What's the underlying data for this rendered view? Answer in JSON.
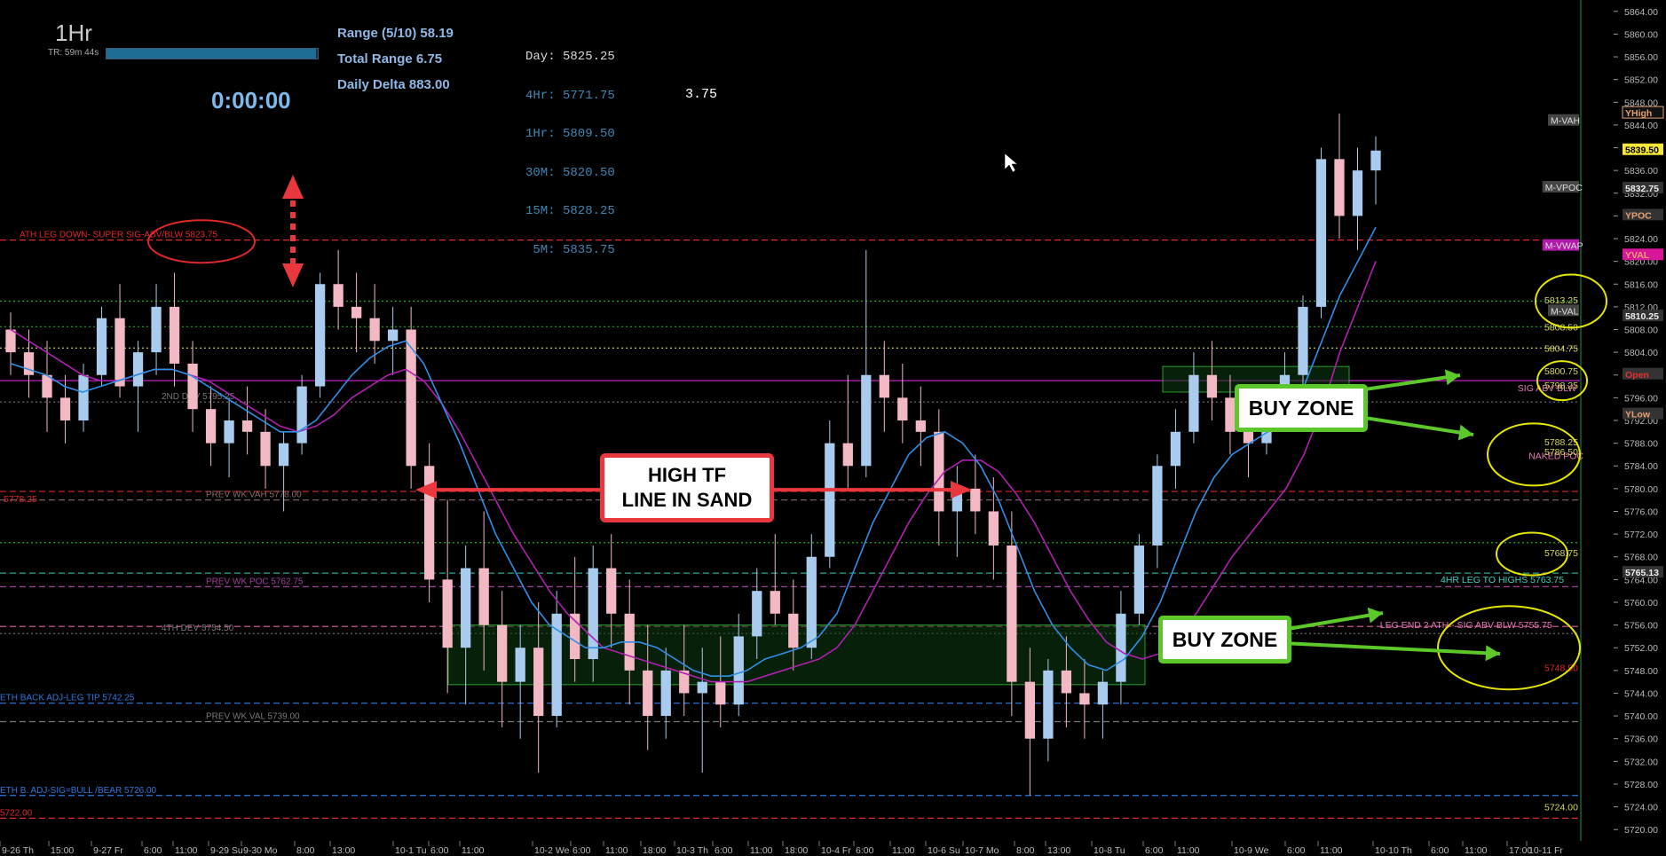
{
  "header": {
    "timeframe": "1Hr",
    "timer_label": "TR: 59m 44s",
    "timer_progress": 0.99,
    "range": "Range (5/10) 58.19",
    "total_range": "Total Range 6.75",
    "daily_delta": "Daily Delta 883.00",
    "clock": "0:00:00",
    "tf_prices": [
      "Day: 5825.25",
      "4Hr: 5771.75",
      "1Hr: 5809.50",
      "30M: 5820.50",
      "15M: 5828.25",
      " 5M: 5835.75"
    ],
    "delta_value": "3.75"
  },
  "callouts": {
    "line_in_sand": [
      "HIGH TF",
      "LINE IN SAND"
    ],
    "buy_zone_upper": "BUY ZONE",
    "buy_zone_lower": "BUY ZONE"
  },
  "colors": {
    "background": "#000000",
    "up_candle": "#a8cbee",
    "down_candle": "#f2b8c4",
    "ema_fast": "#2f8fe6",
    "ema_slow": "#b020b0",
    "callout_red": "#e8383d",
    "callout_green": "#5cc82a",
    "ellipse_yellow": "#e6e600"
  },
  "chart_data": {
    "type": "candlestick",
    "y_axis": {
      "ylim": [
        5718,
        5866
      ],
      "ticks": [
        5720,
        5724,
        5728,
        5732,
        5736,
        5740,
        5744,
        5748,
        5752,
        5756,
        5760,
        5764,
        5768,
        5772,
        5776,
        5780,
        5784,
        5788,
        5792,
        5796,
        5800,
        5804,
        5808,
        5812,
        5816,
        5820,
        5824,
        5828,
        5832,
        5836,
        5840,
        5844,
        5848,
        5852,
        5856,
        5860,
        5864
      ]
    },
    "x_axis": {
      "labels": [
        "9-26 Th",
        "15:00",
        "9-27 Fr",
        "6:00",
        "11:00",
        "9-29 Su",
        "9-30 Mo",
        "8:00",
        "13:00",
        "10-1 Tu",
        "6:00",
        "11:00",
        "10-2 We",
        "6:00",
        "11:00",
        "18:00",
        "10-3 Th",
        "6:00",
        "11:00",
        "18:00",
        "10-4 Fr",
        "6:00",
        "11:00",
        "10-6 Su",
        "10-7 Mo",
        "8:00",
        "13:00",
        "10-8 Tu",
        "6:00",
        "11:00",
        "10-9 We",
        "6:00",
        "11:00",
        "10-10 Th",
        "6:00",
        "11:00",
        "17:00",
        "10-11 Fr"
      ]
    },
    "levels": [
      {
        "price": 5823.75,
        "label": "ATH LEG DOWN- SUPER SIG-ABV/BLW  5823.75",
        "color": "#e02828",
        "style": "dash"
      },
      {
        "price": 5813,
        "label": "",
        "color": "#1fae1f",
        "style": "dot"
      },
      {
        "price": 5808.5,
        "label": "",
        "color": "#1fae1f",
        "style": "dot"
      },
      {
        "price": 5804.75,
        "label": "",
        "color": "#d8d860",
        "style": "dot"
      },
      {
        "price": 5799,
        "label": "",
        "color": "#c020c0",
        "style": "solid"
      },
      {
        "price": 5795.25,
        "label": "2ND DEV  5795.25",
        "color": "#777777",
        "style": "dot"
      },
      {
        "price": 5779.5,
        "label": "",
        "color": "#e02828",
        "style": "dash"
      },
      {
        "price": 5778,
        "label": "PREV WK VAH  5778.00",
        "color": "#8a6a6a",
        "style": "dash"
      },
      {
        "price": 5770.5,
        "label": "",
        "color": "#1fae1f",
        "style": "dot"
      },
      {
        "price": 5765.13,
        "label": "",
        "color": "#2aa89a",
        "style": "dash"
      },
      {
        "price": 5762.75,
        "label": "PREV WK POC  5762.75",
        "color": "#a0409a",
        "style": "dash"
      },
      {
        "price": 5755.75,
        "label": "",
        "color": "#e060a0",
        "style": "dash"
      },
      {
        "price": 5754.5,
        "label": "4TH DEV  5754.50",
        "color": "#777777",
        "style": "dot"
      },
      {
        "price": 5742.25,
        "label": "ETH BACK ADJ-LEG TIP  5742.25",
        "color": "#2f78e0",
        "style": "dash"
      },
      {
        "price": 5739,
        "label": "PREV WK VAL  5739.00",
        "color": "#777777",
        "style": "dash"
      },
      {
        "price": 5726,
        "label": "ETH B. ADJ-SIG=BULL /BEAR  5726.00",
        "color": "#2f78e0",
        "style": "dash"
      },
      {
        "price": 5722,
        "label": "5722.00",
        "color": "#e02828",
        "style": "dash"
      }
    ],
    "right_labels": [
      {
        "price": 5844.5,
        "text": "M-VAH"
      },
      {
        "price": 5832.75,
        "text": "M-VPOC"
      },
      {
        "price": 5822.5,
        "text": "M-VWAP"
      },
      {
        "price": 5811,
        "text": "M-VAL"
      },
      {
        "price": 5797.5,
        "text": "SIG ABV BLW"
      },
      {
        "price": 5785.5,
        "text": "NAKED POC"
      },
      {
        "price": 5763.75,
        "text": "4HR LEG TO HIGHS  5763.75"
      },
      {
        "price": 5755.75,
        "text": "LEG END 2 ATH - SIG ABV BLW  5755.75"
      }
    ],
    "price_labels": [
      {
        "price": 5813.25,
        "text": "5813.25"
      },
      {
        "price": 5808.5,
        "text": "5808.50"
      },
      {
        "price": 5804.75,
        "text": "5804.75"
      },
      {
        "price": 5800.75,
        "text": "5800.75"
      },
      {
        "price": 5798.25,
        "text": "5798.25"
      },
      {
        "price": 5788.25,
        "text": "5788.25"
      },
      {
        "price": 5786.5,
        "text": "5786.50"
      },
      {
        "price": 5768.75,
        "text": "5768.75"
      },
      {
        "price": 5748.5,
        "text": "5748.50"
      },
      {
        "price": 5724,
        "text": "5724.00"
      },
      {
        "price": 5778.25,
        "text": "5778.25"
      }
    ],
    "axis_tags": [
      {
        "price": 5846,
        "text": "YHigh"
      },
      {
        "price": 5839.5,
        "text": "5839.50"
      },
      {
        "price": 5832.75,
        "text": "5832.75"
      },
      {
        "price": 5828,
        "text": "YPOC"
      },
      {
        "price": 5821,
        "text": "YVAL"
      },
      {
        "price": 5810.25,
        "text": "5810.25"
      },
      {
        "price": 5800,
        "text": "Open"
      },
      {
        "price": 5793,
        "text": "YLow"
      },
      {
        "price": 5765.13,
        "text": "5765.13"
      }
    ],
    "candles": [
      {
        "o": 5808,
        "h": 5811,
        "l": 5800,
        "c": 5804
      },
      {
        "o": 5804,
        "h": 5808,
        "l": 5796,
        "c": 5800
      },
      {
        "o": 5800,
        "h": 5806,
        "l": 5790,
        "c": 5796
      },
      {
        "o": 5796,
        "h": 5800,
        "l": 5788,
        "c": 5792
      },
      {
        "o": 5792,
        "h": 5802,
        "l": 5790,
        "c": 5800
      },
      {
        "o": 5800,
        "h": 5812,
        "l": 5798,
        "c": 5810
      },
      {
        "o": 5810,
        "h": 5816,
        "l": 5796,
        "c": 5798
      },
      {
        "o": 5798,
        "h": 5806,
        "l": 5790,
        "c": 5804
      },
      {
        "o": 5804,
        "h": 5816,
        "l": 5800,
        "c": 5812
      },
      {
        "o": 5812,
        "h": 5818,
        "l": 5798,
        "c": 5802
      },
      {
        "o": 5802,
        "h": 5806,
        "l": 5790,
        "c": 5794
      },
      {
        "o": 5794,
        "h": 5798,
        "l": 5784,
        "c": 5788
      },
      {
        "o": 5788,
        "h": 5796,
        "l": 5782,
        "c": 5792
      },
      {
        "o": 5792,
        "h": 5798,
        "l": 5786,
        "c": 5790
      },
      {
        "o": 5790,
        "h": 5794,
        "l": 5780,
        "c": 5784
      },
      {
        "o": 5784,
        "h": 5790,
        "l": 5776,
        "c": 5788
      },
      {
        "o": 5788,
        "h": 5800,
        "l": 5786,
        "c": 5798
      },
      {
        "o": 5798,
        "h": 5818,
        "l": 5796,
        "c": 5816
      },
      {
        "o": 5816,
        "h": 5822,
        "l": 5808,
        "c": 5812
      },
      {
        "o": 5812,
        "h": 5818,
        "l": 5804,
        "c": 5810
      },
      {
        "o": 5810,
        "h": 5816,
        "l": 5802,
        "c": 5806
      },
      {
        "o": 5806,
        "h": 5812,
        "l": 5800,
        "c": 5808
      },
      {
        "o": 5808,
        "h": 5812,
        "l": 5780,
        "c": 5784
      },
      {
        "o": 5784,
        "h": 5788,
        "l": 5760,
        "c": 5764
      },
      {
        "o": 5764,
        "h": 5778,
        "l": 5744,
        "c": 5752
      },
      {
        "o": 5752,
        "h": 5770,
        "l": 5742,
        "c": 5766
      },
      {
        "o": 5766,
        "h": 5776,
        "l": 5748,
        "c": 5756
      },
      {
        "o": 5756,
        "h": 5762,
        "l": 5738,
        "c": 5746
      },
      {
        "o": 5746,
        "h": 5756,
        "l": 5736,
        "c": 5752
      },
      {
        "o": 5752,
        "h": 5760,
        "l": 5730,
        "c": 5740
      },
      {
        "o": 5740,
        "h": 5762,
        "l": 5738,
        "c": 5758
      },
      {
        "o": 5758,
        "h": 5768,
        "l": 5746,
        "c": 5750
      },
      {
        "o": 5750,
        "h": 5770,
        "l": 5746,
        "c": 5766
      },
      {
        "o": 5766,
        "h": 5772,
        "l": 5752,
        "c": 5758
      },
      {
        "o": 5758,
        "h": 5764,
        "l": 5742,
        "c": 5748
      },
      {
        "o": 5748,
        "h": 5756,
        "l": 5734,
        "c": 5740
      },
      {
        "o": 5740,
        "h": 5752,
        "l": 5736,
        "c": 5748
      },
      {
        "o": 5748,
        "h": 5756,
        "l": 5740,
        "c": 5744
      },
      {
        "o": 5744,
        "h": 5752,
        "l": 5730,
        "c": 5746
      },
      {
        "o": 5746,
        "h": 5754,
        "l": 5738,
        "c": 5742
      },
      {
        "o": 5742,
        "h": 5758,
        "l": 5740,
        "c": 5754
      },
      {
        "o": 5754,
        "h": 5766,
        "l": 5750,
        "c": 5762
      },
      {
        "o": 5762,
        "h": 5772,
        "l": 5756,
        "c": 5758
      },
      {
        "o": 5758,
        "h": 5764,
        "l": 5748,
        "c": 5752
      },
      {
        "o": 5752,
        "h": 5772,
        "l": 5750,
        "c": 5768
      },
      {
        "o": 5768,
        "h": 5792,
        "l": 5766,
        "c": 5788
      },
      {
        "o": 5788,
        "h": 5800,
        "l": 5780,
        "c": 5784
      },
      {
        "o": 5784,
        "h": 5822,
        "l": 5782,
        "c": 5800
      },
      {
        "o": 5800,
        "h": 5806,
        "l": 5790,
        "c": 5796
      },
      {
        "o": 5796,
        "h": 5802,
        "l": 5788,
        "c": 5792
      },
      {
        "o": 5792,
        "h": 5798,
        "l": 5784,
        "c": 5790
      },
      {
        "o": 5790,
        "h": 5794,
        "l": 5770,
        "c": 5776
      },
      {
        "o": 5776,
        "h": 5784,
        "l": 5768,
        "c": 5780
      },
      {
        "o": 5780,
        "h": 5786,
        "l": 5772,
        "c": 5776
      },
      {
        "o": 5776,
        "h": 5782,
        "l": 5764,
        "c": 5770
      },
      {
        "o": 5770,
        "h": 5776,
        "l": 5740,
        "c": 5746
      },
      {
        "o": 5746,
        "h": 5752,
        "l": 5726,
        "c": 5736
      },
      {
        "o": 5736,
        "h": 5750,
        "l": 5732,
        "c": 5748
      },
      {
        "o": 5748,
        "h": 5754,
        "l": 5738,
        "c": 5744
      },
      {
        "o": 5744,
        "h": 5750,
        "l": 5736,
        "c": 5742
      },
      {
        "o": 5742,
        "h": 5748,
        "l": 5736,
        "c": 5746
      },
      {
        "o": 5746,
        "h": 5762,
        "l": 5742,
        "c": 5758
      },
      {
        "o": 5758,
        "h": 5772,
        "l": 5756,
        "c": 5770
      },
      {
        "o": 5770,
        "h": 5786,
        "l": 5766,
        "c": 5784
      },
      {
        "o": 5784,
        "h": 5794,
        "l": 5780,
        "c": 5790
      },
      {
        "o": 5790,
        "h": 5804,
        "l": 5788,
        "c": 5800
      },
      {
        "o": 5800,
        "h": 5806,
        "l": 5792,
        "c": 5796
      },
      {
        "o": 5796,
        "h": 5800,
        "l": 5786,
        "c": 5790
      },
      {
        "o": 5790,
        "h": 5794,
        "l": 5782,
        "c": 5788
      },
      {
        "o": 5788,
        "h": 5798,
        "l": 5786,
        "c": 5796
      },
      {
        "o": 5796,
        "h": 5804,
        "l": 5794,
        "c": 5800
      },
      {
        "o": 5800,
        "h": 5814,
        "l": 5798,
        "c": 5812
      },
      {
        "o": 5812,
        "h": 5840,
        "l": 5810,
        "c": 5838
      },
      {
        "o": 5838,
        "h": 5846,
        "l": 5824,
        "c": 5828
      },
      {
        "o": 5828,
        "h": 5840,
        "l": 5822,
        "c": 5836
      },
      {
        "o": 5836,
        "h": 5842,
        "l": 5830,
        "c": 5839.5
      }
    ],
    "ema_fast_values": [
      5802,
      5801,
      5800,
      5798,
      5797,
      5798,
      5799,
      5800,
      5801,
      5801,
      5800,
      5798,
      5796,
      5794,
      5792,
      5790,
      5790,
      5792,
      5796,
      5800,
      5803,
      5805,
      5806,
      5802,
      5795,
      5788,
      5780,
      5772,
      5766,
      5760,
      5756,
      5754,
      5752,
      5752,
      5753,
      5753,
      5752,
      5750,
      5748,
      5747,
      5747,
      5748,
      5750,
      5751,
      5752,
      5754,
      5758,
      5766,
      5774,
      5780,
      5786,
      5789,
      5790,
      5788,
      5784,
      5778,
      5770,
      5762,
      5756,
      5752,
      5749,
      5748,
      5750,
      5754,
      5760,
      5768,
      5776,
      5782,
      5786,
      5788,
      5790,
      5793,
      5798,
      5806,
      5814,
      5820,
      5826
    ],
    "ema_slow_values": [
      5808,
      5806,
      5804,
      5802,
      5800,
      5799,
      5799,
      5800,
      5801,
      5801,
      5800,
      5799,
      5797,
      5795,
      5793,
      5791,
      5790,
      5791,
      5793,
      5796,
      5798,
      5800,
      5801,
      5799,
      5795,
      5790,
      5784,
      5778,
      5772,
      5767,
      5762,
      5758,
      5755,
      5752,
      5751,
      5750,
      5749,
      5748,
      5747,
      5746,
      5746,
      5746,
      5747,
      5748,
      5749,
      5750,
      5752,
      5756,
      5762,
      5768,
      5774,
      5779,
      5783,
      5785,
      5785,
      5783,
      5779,
      5774,
      5768,
      5762,
      5757,
      5753,
      5751,
      5750,
      5751,
      5754,
      5758,
      5763,
      5768,
      5772,
      5776,
      5780,
      5786,
      5794,
      5804,
      5812,
      5820
    ]
  }
}
